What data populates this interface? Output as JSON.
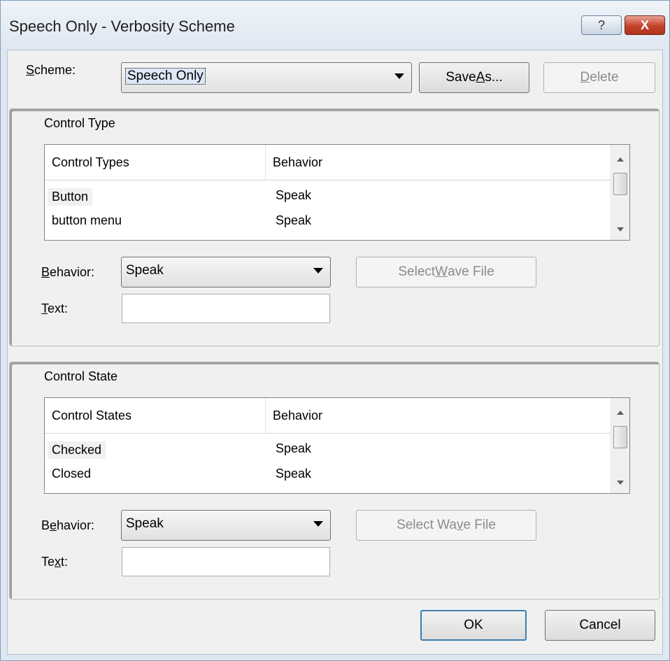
{
  "window": {
    "title": "Speech Only - Verbosity Scheme",
    "help_glyph": "?",
    "close_glyph": "X"
  },
  "scheme": {
    "label_first": "S",
    "label_rest": "cheme:",
    "value": "Speech Only",
    "save_as_prefix": "Save ",
    "save_as_key": "A",
    "save_as_suffix": "s...",
    "delete_key": "D",
    "delete_rest": "elete"
  },
  "control_type": {
    "group_title": "Control Type",
    "columns": [
      "Control Types",
      "Behavior"
    ],
    "rows": [
      {
        "name": "Button",
        "behavior": "Speak"
      },
      {
        "name": "button menu",
        "behavior": "Speak"
      }
    ],
    "behavior_label_key": "B",
    "behavior_label_rest": "ehavior:",
    "behavior_value": "Speak",
    "wave_prefix": "Select ",
    "wave_key": "W",
    "wave_suffix": "ave File",
    "text_label_key": "T",
    "text_label_rest": "ext:",
    "text_value": ""
  },
  "control_state": {
    "group_title": "Control State",
    "columns": [
      "Control States",
      "Behavior"
    ],
    "rows": [
      {
        "name": "Checked",
        "behavior": "Speak"
      },
      {
        "name": "Closed",
        "behavior": "Speak"
      }
    ],
    "behavior_label_pre": "B",
    "behavior_label_key": "e",
    "behavior_label_rest": "havior:",
    "behavior_value": "Speak",
    "wave_prefix": "Select Wa",
    "wave_key": "v",
    "wave_suffix": "e File",
    "text_label_pre": "Te",
    "text_label_key": "x",
    "text_label_rest": "t:",
    "text_value": ""
  },
  "footer": {
    "ok": "OK",
    "cancel": "Cancel"
  }
}
